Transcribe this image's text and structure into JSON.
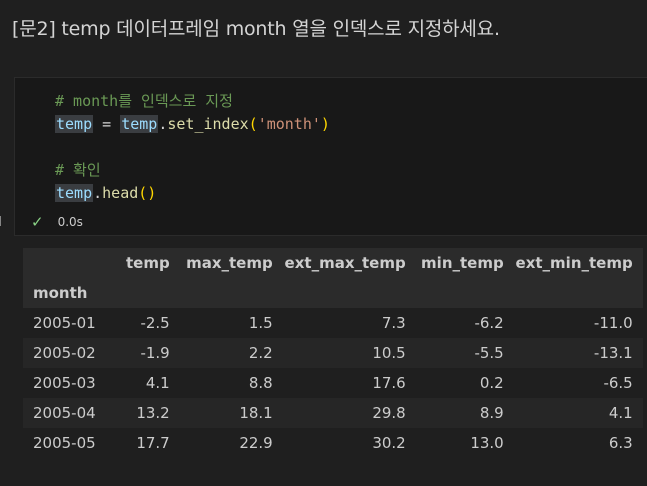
{
  "markdown": {
    "title": "[문2] temp 데이터프레임 month 열을 인덱스로 지정하세요."
  },
  "code_cell": {
    "line1_comment": "# month를 인덱스로 지정",
    "line2_var1": "temp",
    "line2_eq": " = ",
    "line2_var2": "temp",
    "line2_dot": ".",
    "line2_fn": "set_index",
    "line2_open": "(",
    "line2_str": "'month'",
    "line2_close": ")",
    "line4_comment": "# 확인",
    "line5_var": "temp",
    "line5_dot": ".",
    "line5_fn": "head",
    "line5_parens": "()",
    "exec_time": "0.0s",
    "status_icon": "check-icon"
  },
  "output_table": {
    "columns": [
      "temp",
      "max_temp",
      "ext_max_temp",
      "min_temp",
      "ext_min_temp"
    ],
    "index_name": "month",
    "rows": [
      {
        "month": "2005-01",
        "temp": "-2.5",
        "max_temp": "1.5",
        "ext_max_temp": "7.3",
        "min_temp": "-6.2",
        "ext_min_temp": "-11.0"
      },
      {
        "month": "2005-02",
        "temp": "-1.9",
        "max_temp": "2.2",
        "ext_max_temp": "10.5",
        "min_temp": "-5.5",
        "ext_min_temp": "-13.1"
      },
      {
        "month": "2005-03",
        "temp": "4.1",
        "max_temp": "8.8",
        "ext_max_temp": "17.6",
        "min_temp": "0.2",
        "ext_min_temp": "-6.5"
      },
      {
        "month": "2005-04",
        "temp": "13.2",
        "max_temp": "18.1",
        "ext_max_temp": "29.8",
        "min_temp": "8.9",
        "ext_min_temp": "4.1"
      },
      {
        "month": "2005-05",
        "temp": "17.7",
        "max_temp": "22.9",
        "ext_max_temp": "30.2",
        "min_temp": "13.0",
        "ext_min_temp": "6.3"
      }
    ]
  }
}
